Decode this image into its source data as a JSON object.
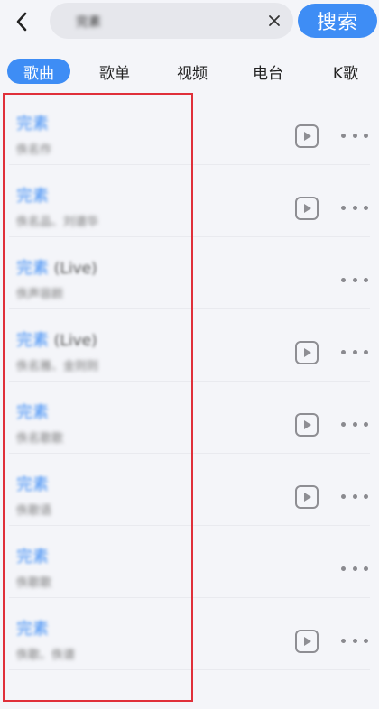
{
  "search": {
    "query": "完素",
    "button_label": "搜索"
  },
  "tabs": [
    {
      "label": "歌曲",
      "active": true
    },
    {
      "label": "歌单",
      "active": false
    },
    {
      "label": "视频",
      "active": false
    },
    {
      "label": "电台",
      "active": false
    },
    {
      "label": "K歌",
      "active": false
    }
  ],
  "songs": [
    {
      "title": "完素",
      "tag": "",
      "artist": "佚名作",
      "has_play": true
    },
    {
      "title": "完素",
      "tag": "",
      "artist": "佚名品、刘谱华",
      "has_play": true
    },
    {
      "title": "完素",
      "tag": "(Live)",
      "artist": "佚声容颜",
      "has_play": false
    },
    {
      "title": "完素",
      "tag": "(Live)",
      "artist": "佚名雅、金则则",
      "has_play": true
    },
    {
      "title": "完素",
      "tag": "",
      "artist": "佚名歌歌",
      "has_play": true
    },
    {
      "title": "完素",
      "tag": "",
      "artist": "佚歌语",
      "has_play": true
    },
    {
      "title": "完素",
      "tag": "",
      "artist": "佚歌歌",
      "has_play": false
    },
    {
      "title": "完素",
      "tag": "",
      "artist": "佚歌、佚谱",
      "has_play": true
    }
  ],
  "colors": {
    "accent": "#3e8df5",
    "highlight_box": "#e0303a",
    "background": "#f4f5f9"
  },
  "icons": {
    "back": "chevron-left-icon",
    "clear": "close-icon",
    "play": "play-icon",
    "more": "more-icon"
  }
}
